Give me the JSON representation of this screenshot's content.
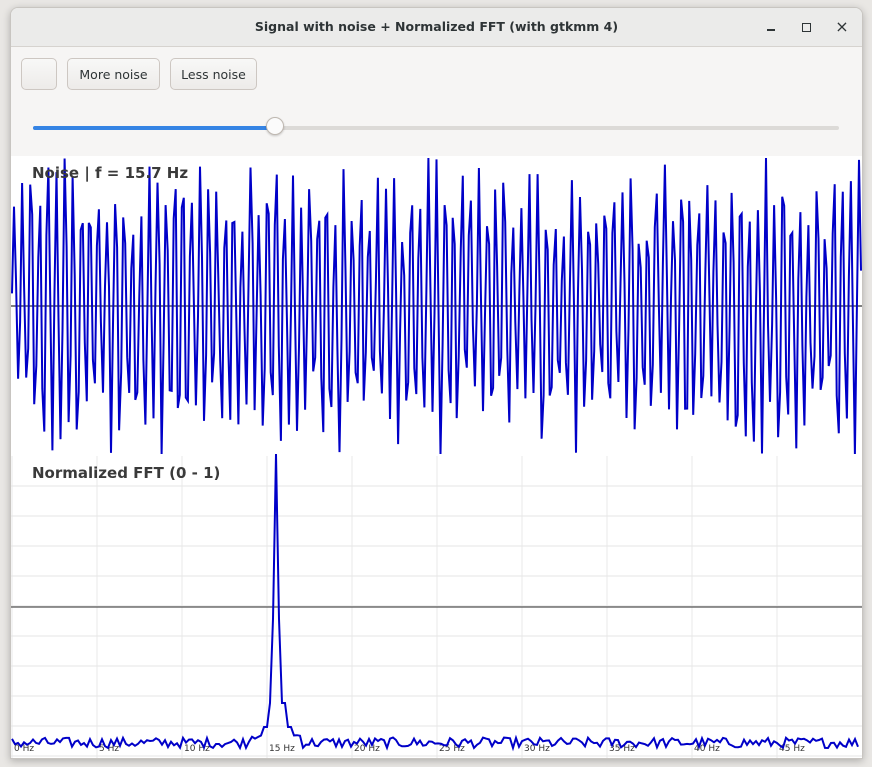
{
  "window": {
    "title": "Signal with noise + Normalized FFT (with gtkmm 4)",
    "controls": {
      "minimize": "minimize-icon",
      "maximize": "maximize-icon",
      "close": "×"
    }
  },
  "toolbar": {
    "blank_label": "",
    "more_noise_label": "More noise",
    "less_noise_label": "Less noise"
  },
  "slider": {
    "value": 0.3,
    "accent": "#3584e4"
  },
  "plots": {
    "signal_label": "Noise | f = 15.7 Hz",
    "fft_label": "Normalized FFT (0 - 1)",
    "line_color": "#0000c8"
  },
  "chart_data": [
    {
      "type": "line",
      "title": "Noise | f = 15.7 Hz",
      "frequency_hz": 15.7,
      "series": [
        {
          "values": []
        }
      ]
    },
    {
      "type": "line",
      "title": "Normalized FFT (0 - 1)",
      "categories": [
        "0 Hz",
        "5 Hz",
        "10 Hz",
        "15 Hz",
        "20 Hz",
        "25 Hz",
        "30 Hz",
        "35 Hz",
        "40 Hz",
        "45 Hz"
      ],
      "peak_hz": 15.7,
      "peak_value": 1.0,
      "ylim": [
        0,
        1
      ],
      "grid": true
    }
  ]
}
